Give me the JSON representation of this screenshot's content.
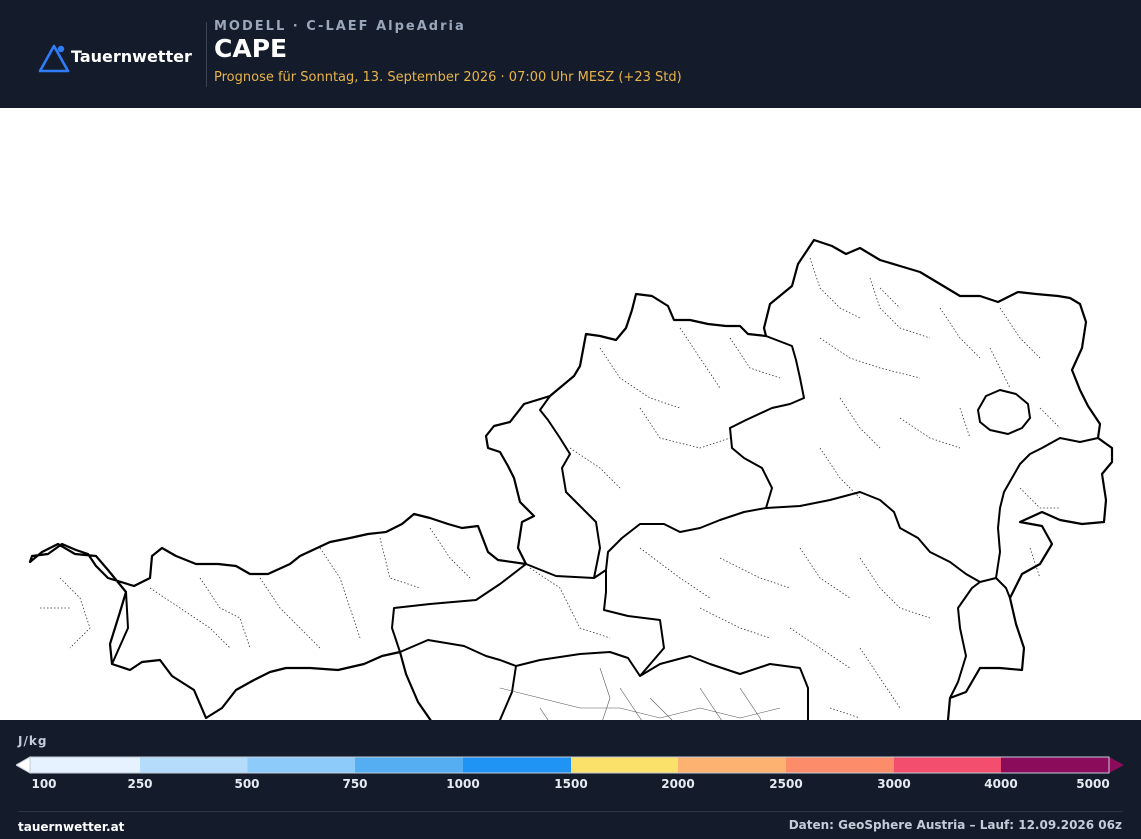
{
  "header": {
    "brand": "Tauernwetter",
    "model_label": "MODELL · C-LAEF AlpeAdria",
    "parameter": "CAPE",
    "forecast_text": "Prognose für Sonntag, 13. September 2026 · 07:00 Uhr MESZ  (+23 Std)"
  },
  "map": {
    "region": "Austria",
    "field_state": "no CAPE shading shown (all values below lowest class)"
  },
  "legend": {
    "unit": "J/kg",
    "ticks": [
      "100",
      "250",
      "500",
      "750",
      "1000",
      "1500",
      "2000",
      "2500",
      "3000",
      "4000",
      "5000"
    ],
    "colors": [
      "#e6f2ff",
      "#b5dcfb",
      "#8ccbfa",
      "#55aef1",
      "#1f94f4",
      "#fbe06a",
      "#fdb272",
      "#fd8c6b",
      "#f44e6e",
      "#8c0c5c"
    ],
    "under_color": "#ffffff",
    "over_color": "#8c0c5c"
  },
  "footer": {
    "site": "tauernwetter.at",
    "source": "Daten: GeoSphere Austria – Lauf: 12.09.2026 06z"
  },
  "style": {
    "header_bg": "#141c2b",
    "accent_text": "#e8b349",
    "logo_blue": "#2f7cf6"
  }
}
